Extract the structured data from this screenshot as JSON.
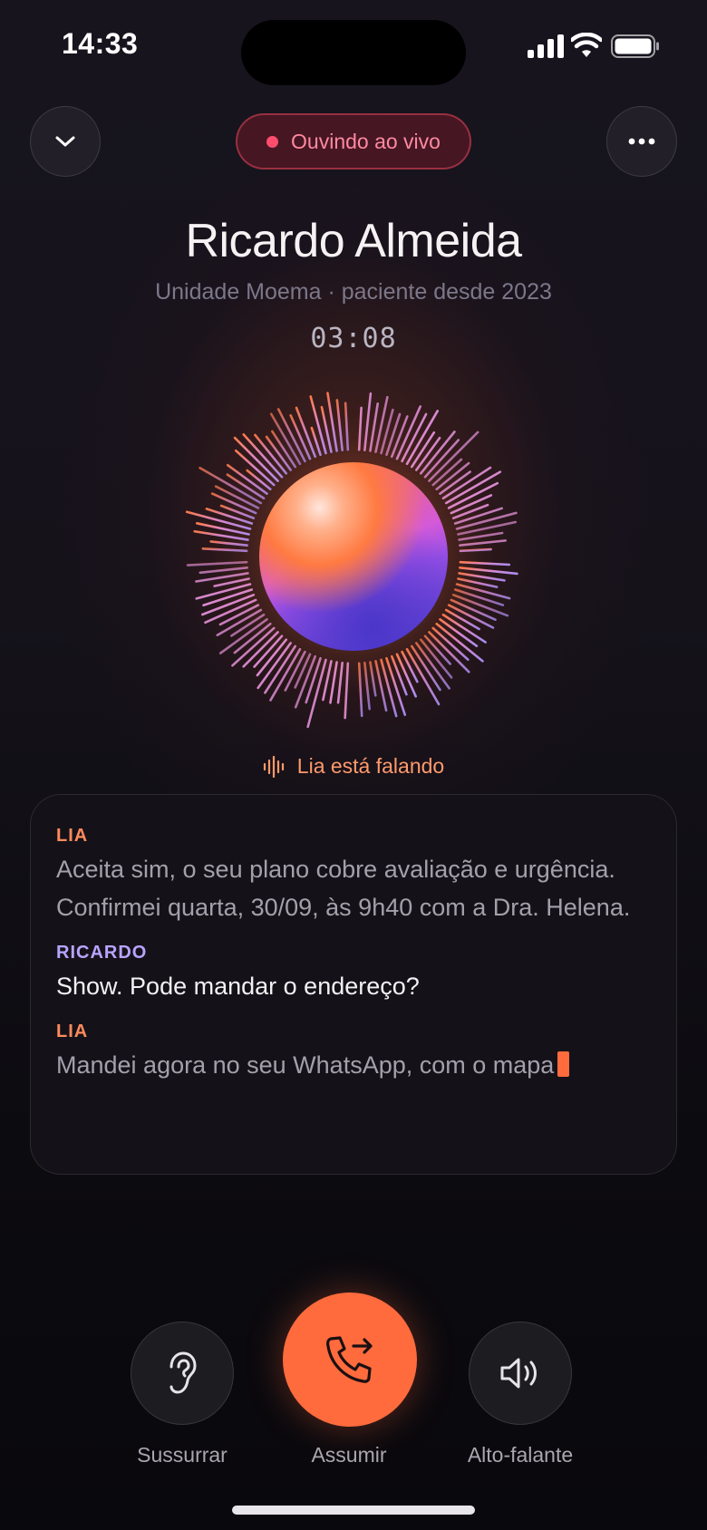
{
  "status_bar": {
    "time": "14:33",
    "icons": [
      "signal-icon",
      "wifi-icon",
      "battery-icon"
    ]
  },
  "header": {
    "minimize_icon": "chevron-down-icon",
    "live_label": "Ouvindo ao vivo",
    "more_icon": "more-dots-icon"
  },
  "caller": {
    "name": "Ricardo Almeida",
    "subtitle": "Unidade Moema · paciente desde 2023",
    "duration": "03:08"
  },
  "activity": {
    "label": "Lia está falando",
    "icon": "audio-wave-icon"
  },
  "transcript": [
    {
      "speaker": "LIA",
      "text": "Aceita sim, o seu plano cobre avaliação e urgência. Confirmei quarta, 30/09, às 9h40 com a Dra. Helena."
    },
    {
      "speaker": "RICARDO",
      "text": "Show. Pode mandar o endereço?"
    },
    {
      "speaker": "LIA",
      "text": "Mandei agora no seu WhatsApp, com o mapa"
    }
  ],
  "controls": {
    "whisper": {
      "label": "Sussurrar",
      "icon": "ear-icon"
    },
    "takeover": {
      "label": "Assumir",
      "icon": "phone-transfer-icon"
    },
    "speaker": {
      "label": "Alto-falante",
      "icon": "speaker-icon"
    }
  },
  "colors": {
    "accent": "#ff6b3d",
    "live": "#ff4d6d",
    "lia": "#ff8a5c",
    "ricardo": "#b7a4ff"
  }
}
